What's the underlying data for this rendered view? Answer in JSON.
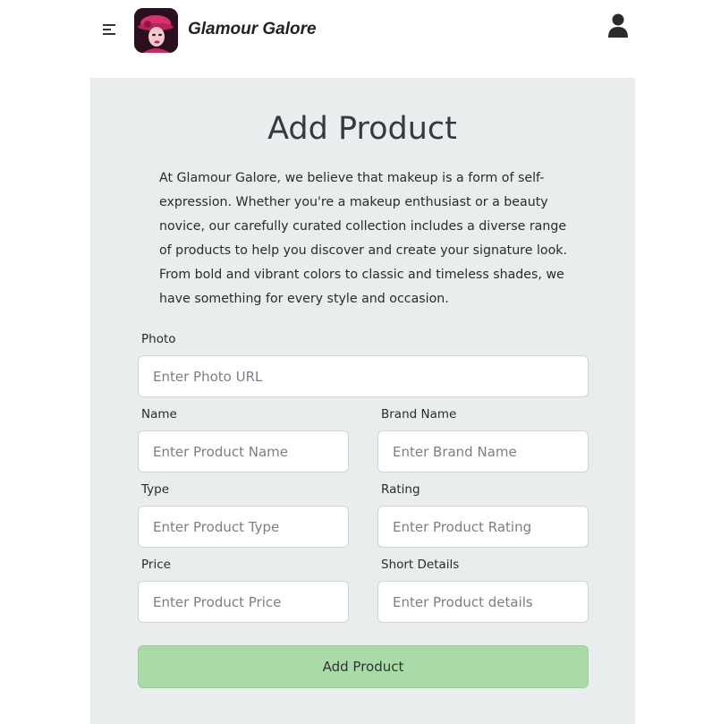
{
  "navbar": {
    "brand": "Glamour Galore",
    "menu_icon": "hamburger-icon",
    "user_icon": "user-icon"
  },
  "form": {
    "title": "Add Product",
    "description": "At Glamour Galore, we believe that makeup is a form of self-expression. Whether you're a makeup enthusiast or a beauty novice, our carefully curated collection includes a diverse range of products to help you discover and create your signature look. From bold and vibrant colors to classic and timeless shades, we have something for every style and occasion.",
    "photo": {
      "label": "Photo",
      "placeholder": "Enter Photo URL"
    },
    "name": {
      "label": "Name",
      "placeholder": "Enter Product Name"
    },
    "brand": {
      "label": "Brand Name",
      "placeholder": "Enter Brand Name"
    },
    "type": {
      "label": "Type",
      "placeholder": "Enter Product Type"
    },
    "rating": {
      "label": "Rating",
      "placeholder": "Enter Product Rating"
    },
    "price": {
      "label": "Price",
      "placeholder": "Enter Product Price"
    },
    "details": {
      "label": "Short Details",
      "placeholder": "Enter Product details"
    },
    "submit_label": "Add Product"
  },
  "colors": {
    "panel_bg": "#e9edee",
    "submit_bg": "#a8dba8",
    "logo_bg": "#2a0f1e"
  }
}
